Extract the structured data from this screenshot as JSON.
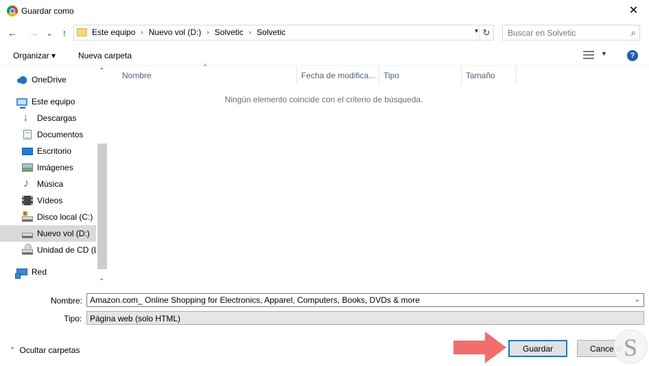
{
  "window": {
    "title": "Guardar como",
    "close_glyph": "✕"
  },
  "nav": {
    "back_glyph": "←",
    "forward_glyph": "→",
    "recent_glyph": "⌄",
    "up_glyph": "↑",
    "breadcrumb": [
      "Este equipo",
      "Nuevo vol (D:)",
      "Solvetic",
      "Solvetic"
    ],
    "separator": "›",
    "refresh_glyph": "↻",
    "search_placeholder": "Buscar en Solvetic",
    "search_glyph": "⌕"
  },
  "toolbar": {
    "organize_label": "Organizar ▾",
    "new_folder_label": "Nueva carpeta",
    "view_dd": "▼",
    "help": "?"
  },
  "sidebar": {
    "items": [
      {
        "label": "OneDrive"
      },
      {
        "label": "Este equipo"
      },
      {
        "label": "Descargas"
      },
      {
        "label": "Documentos"
      },
      {
        "label": "Escritorio"
      },
      {
        "label": "Imágenes"
      },
      {
        "label": "Música"
      },
      {
        "label": "Vídeos"
      },
      {
        "label": "Disco local (C:)"
      },
      {
        "label": "Nuevo vol (D:)"
      },
      {
        "label": "Unidad de CD (L"
      },
      {
        "label": "Red"
      }
    ],
    "scroll_up": "⌃",
    "scroll_down": "⌄"
  },
  "filelist": {
    "columns": [
      "Nombre",
      "Fecha de modifica...",
      "Tipo",
      "Tamaño"
    ],
    "sort_glyph": "^",
    "empty_message": "Ningún elemento coincide con el criterio de búsqueda."
  },
  "form": {
    "name_label": "Nombre:",
    "name_value": "Amazon.com_ Online Shopping for Electronics, Apparel, Computers, Books, DVDs & more",
    "type_label": "Tipo:",
    "type_value": "Página web (solo HTML)",
    "caret": "⌄"
  },
  "footer": {
    "hide_folders_label": "Ocultar carpetas",
    "hide_chevron": "⌃",
    "save_label": "Guardar",
    "cancel_label": "Cancelar"
  },
  "colors": {
    "accent": "#0078d7",
    "arrow": "#f26d6d",
    "selected_nav": "#d9d9d9"
  }
}
